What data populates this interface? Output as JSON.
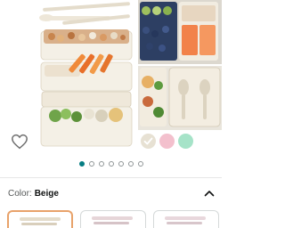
{
  "product": {
    "image_icon": "bento-lunch-box-product-photo",
    "wishlist_icon": "heart-outline-icon"
  },
  "swatches": [
    {
      "name": "beige",
      "color": "#e7e1d3",
      "selected": true
    },
    {
      "name": "pink",
      "color": "#f3c0cd",
      "selected": false
    },
    {
      "name": "green",
      "color": "#a6e3c8",
      "selected": false
    }
  ],
  "carousel": {
    "count": 7,
    "active_index": 1
  },
  "variation": {
    "label": "Color:",
    "value": "Beige",
    "toggle_icon": "chevron-up-icon"
  },
  "colors": {
    "accent": "#067d83",
    "selected_border": "#e8a26a"
  }
}
